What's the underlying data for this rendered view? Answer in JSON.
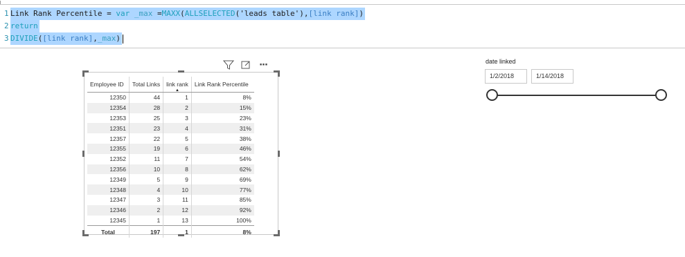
{
  "formula": {
    "lines": [
      {
        "num": "1",
        "tokens": [
          {
            "t": "Link Rank Percentile = ",
            "c": "plain"
          },
          {
            "t": "var",
            "c": "kw"
          },
          {
            "t": " _max ",
            "c": "var"
          },
          {
            "t": "=",
            "c": "plain"
          },
          {
            "t": "MAXX",
            "c": "fn"
          },
          {
            "t": "(",
            "c": "plain"
          },
          {
            "t": "ALLSELECTED",
            "c": "fn"
          },
          {
            "t": "(",
            "c": "plain"
          },
          {
            "t": "'leads table'",
            "c": "plain"
          },
          {
            "t": "),",
            "c": "plain"
          },
          {
            "t": "[link rank]",
            "c": "ref"
          },
          {
            "t": ")",
            "c": "plain"
          }
        ]
      },
      {
        "num": "2",
        "tokens": [
          {
            "t": "return",
            "c": "kw"
          }
        ]
      },
      {
        "num": "3",
        "tokens": [
          {
            "t": "DIVIDE",
            "c": "fn"
          },
          {
            "t": "(",
            "c": "plain"
          },
          {
            "t": "[link rank]",
            "c": "ref"
          },
          {
            "t": ",",
            "c": "plain"
          },
          {
            "t": "_max",
            "c": "var"
          },
          {
            "t": ")",
            "c": "plain"
          }
        ]
      }
    ]
  },
  "visual_header": {
    "icons": [
      "filter-icon",
      "focus-mode-icon",
      "more-options-icon"
    ],
    "more_glyph": "···"
  },
  "table": {
    "columns": [
      "Employee ID",
      "Total Links",
      "link rank",
      "Link Rank Percentile"
    ],
    "sorted_column": "link rank",
    "sort_direction": "ascending",
    "rows": [
      [
        "12350",
        "44",
        "1",
        "8%"
      ],
      [
        "12354",
        "28",
        "2",
        "15%"
      ],
      [
        "12353",
        "25",
        "3",
        "23%"
      ],
      [
        "12351",
        "23",
        "4",
        "31%"
      ],
      [
        "12357",
        "22",
        "5",
        "38%"
      ],
      [
        "12355",
        "19",
        "6",
        "46%"
      ],
      [
        "12352",
        "11",
        "7",
        "54%"
      ],
      [
        "12356",
        "10",
        "8",
        "62%"
      ],
      [
        "12349",
        "5",
        "9",
        "69%"
      ],
      [
        "12348",
        "4",
        "10",
        "77%"
      ],
      [
        "12347",
        "3",
        "11",
        "85%"
      ],
      [
        "12346",
        "2",
        "12",
        "92%"
      ],
      [
        "12345",
        "1",
        "13",
        "100%"
      ]
    ],
    "total": [
      "Total",
      "197",
      "1",
      "8%"
    ]
  },
  "slicer": {
    "title": "date linked",
    "start_date": "1/2/2018",
    "end_date": "1/14/2018",
    "range_selected": [
      0,
      1
    ]
  },
  "colors": {
    "selection": "#add6ff",
    "line_number": "#2b91af",
    "keyword": "#1c9fbb",
    "alt_row": "#efefef"
  }
}
